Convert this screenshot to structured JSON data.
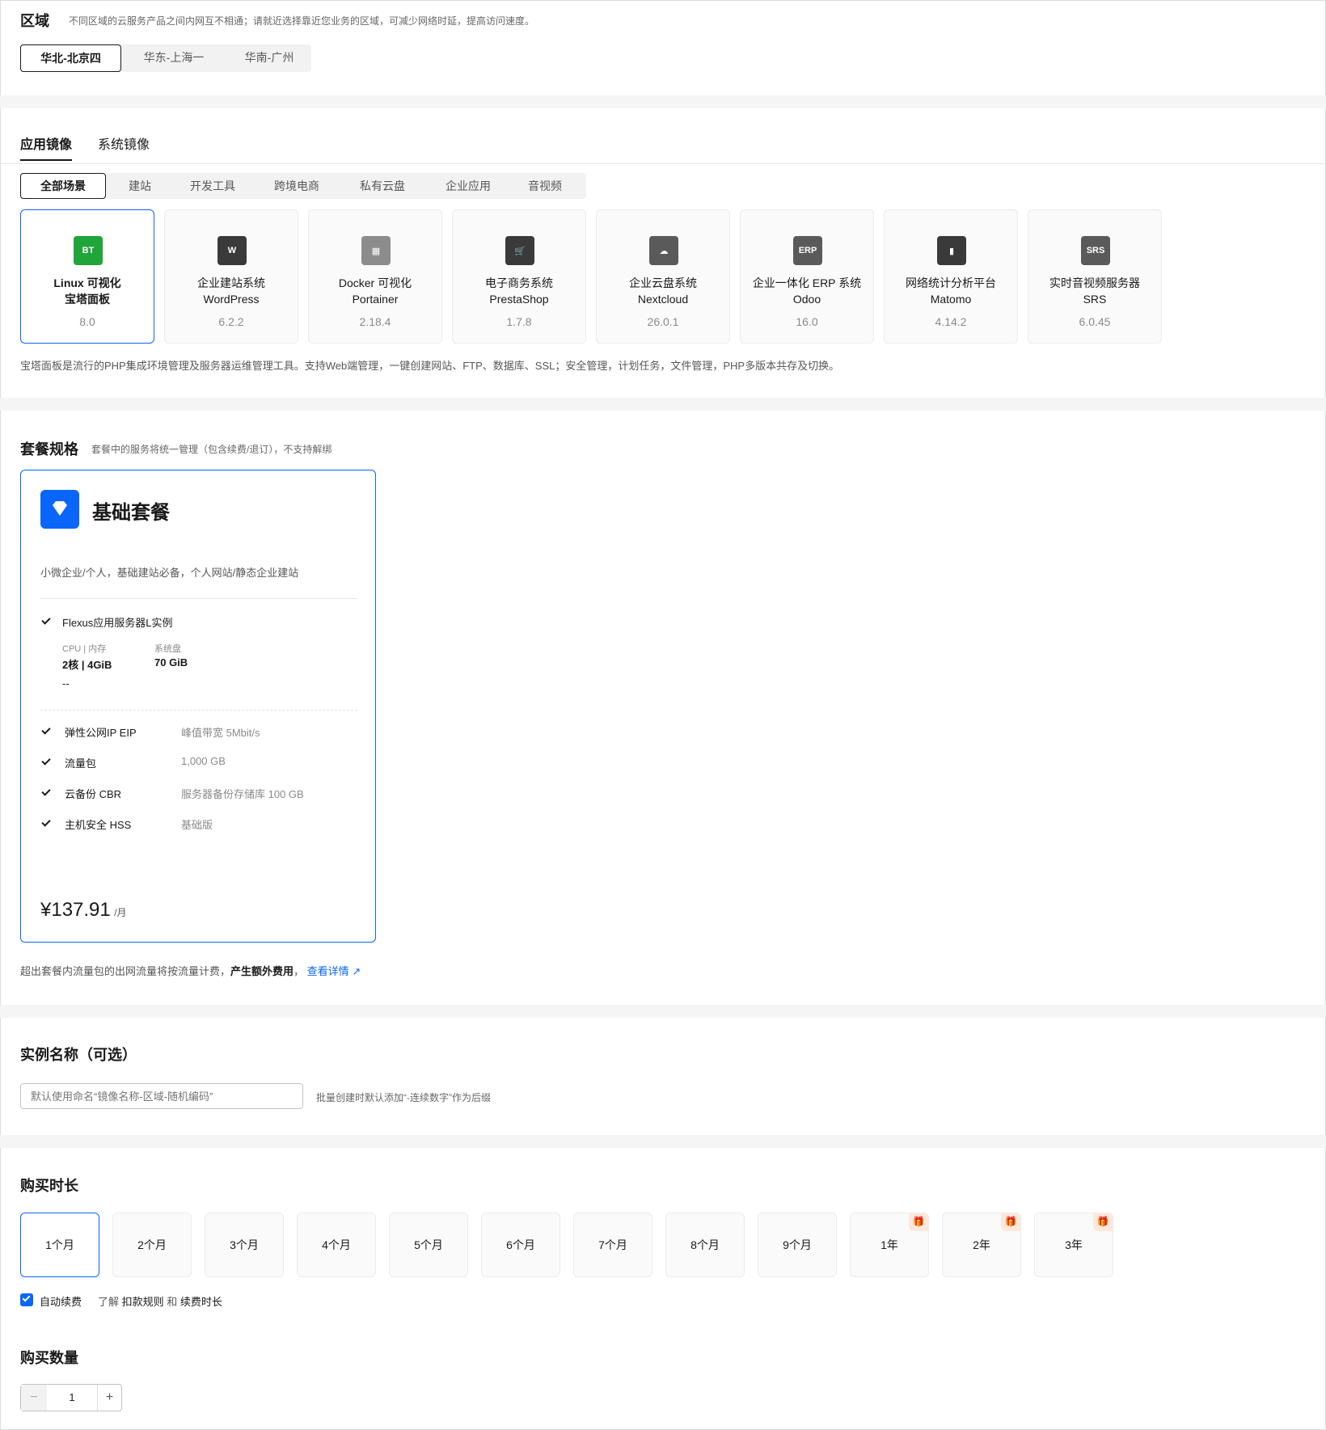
{
  "region": {
    "title": "区域",
    "desc": "不同区域的云服务产品之间内网互不相通；请就近选择靠近您业务的区域，可减少网络时延，提高访问速度。",
    "options": [
      "华北-北京四",
      "华东-上海一",
      "华南-广州"
    ],
    "selected": "华北-北京四"
  },
  "image": {
    "tabs": [
      "应用镜像",
      "系统镜像"
    ],
    "scenes": [
      "全部场景",
      "建站",
      "开发工具",
      "跨境电商",
      "私有云盘",
      "企业应用",
      "音视频"
    ],
    "cards": [
      {
        "line1": "Linux 可视化",
        "line2": "宝塔面板",
        "version": "8.0",
        "icon": "bt-panel-icon",
        "glyph": "BT",
        "color": "#20a53a"
      },
      {
        "line1": "企业建站系统",
        "line2": "WordPress",
        "version": "6.2.2",
        "icon": "wordpress-icon",
        "glyph": "W",
        "color": "#3a3a3a"
      },
      {
        "line1": "Docker 可视化",
        "line2": "Portainer",
        "version": "2.18.4",
        "icon": "portainer-icon",
        "glyph": "▦",
        "color": "#8c8c8c"
      },
      {
        "line1": "电子商务系统",
        "line2": "PrestaShop",
        "version": "1.7.8",
        "icon": "shopping-cart-icon",
        "glyph": "🛒",
        "color": "#3a3a3a"
      },
      {
        "line1": "企业云盘系统",
        "line2": "Nextcloud",
        "version": "26.0.1",
        "icon": "cloud-icon",
        "glyph": "☁",
        "color": "#5a5a5a"
      },
      {
        "line1": "企业一体化 ERP 系统",
        "line2": "Odoo",
        "version": "16.0",
        "icon": "erp-icon",
        "glyph": "ERP",
        "color": "#5a5a5a"
      },
      {
        "line1": "网络统计分析平台",
        "line2": "Matomo",
        "version": "4.14.2",
        "icon": "bar-chart-icon",
        "glyph": "▮",
        "color": "#3a3a3a"
      },
      {
        "line1": "实时音视频服务器",
        "line2": "SRS",
        "version": "6.0.45",
        "icon": "srs-icon",
        "glyph": "SRS",
        "color": "#5a5a5a"
      }
    ],
    "description": "宝塔面板是流行的PHP集成环境管理及服务器运维管理工具。支持Web端管理，一键创建网站、FTP、数据库、SSL；安全管理，计划任务，文件管理，PHP多版本共存及切换。"
  },
  "package": {
    "title": "套餐规格",
    "subtitle": "套餐中的服务将统一管理（包含续费/退订），不支持解绑",
    "name": "基础套餐",
    "desc": "小微企业/个人，基础建站必备，个人网站/静态企业建站",
    "instance_label": "Flexus应用服务器L实例",
    "cpu_label": "CPU | 内存",
    "cpu_value": "2核 | 4GiB",
    "disk_label": "系统盘",
    "disk_value": "70 GiB",
    "placeholder_dash": "--",
    "features": [
      {
        "name": "弹性公网IP EIP",
        "value": "峰值带宽 5Mbit/s"
      },
      {
        "name": "流量包",
        "value": "1,000 GB"
      },
      {
        "name": "云备份 CBR",
        "value": "服务器备份存储库 100 GB"
      },
      {
        "name": "主机安全 HSS",
        "value": "基础版"
      }
    ],
    "price": "¥137.91",
    "price_unit": "/月",
    "note_prefix": "超出套餐内流量包的出网流量将按流量计费，",
    "note_bold": "产生额外费用",
    "note_comma": "，",
    "note_link": "查看详情"
  },
  "instance": {
    "title": "实例名称（可选）",
    "placeholder": "默认使用命名“镜像名称-区域-随机编码”",
    "hint": "批量创建时默认添加“-连续数字”作为后缀"
  },
  "duration": {
    "title": "购买时长",
    "options": [
      "1个月",
      "2个月",
      "3个月",
      "4个月",
      "5个月",
      "6个月",
      "7个月",
      "8个月",
      "9个月",
      "1年",
      "2年",
      "3年"
    ],
    "gift_flags": [
      false,
      false,
      false,
      false,
      false,
      false,
      false,
      false,
      false,
      true,
      true,
      true
    ],
    "selected": "1个月",
    "auto_renew_label": "自动续费",
    "learn_prefix": "了解",
    "rule_link": "扣款规则",
    "and_text": "和",
    "renew_link": "续费时长",
    "auto_renew_checked": true
  },
  "quantity": {
    "title": "购买数量",
    "value": "1",
    "minus": "−",
    "plus": "+"
  },
  "colors": {
    "accent": "#0a65fa",
    "bt_green": "#20a53a",
    "gift_orange": "#e2762c"
  }
}
